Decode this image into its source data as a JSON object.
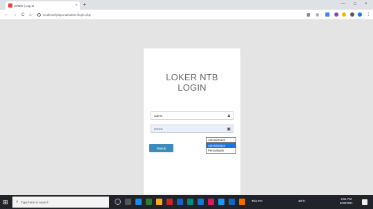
{
  "browser": {
    "tab_title": "ERES | Log in",
    "tab_close": "×",
    "new_tab": "+",
    "url": "localhost/jobportal/admin/login.php",
    "back": "←",
    "forward": "→",
    "reload": "C",
    "home": "⌂",
    "minimize": "—",
    "maximize": "□",
    "close": "×"
  },
  "login": {
    "brand_line1": "LOKER NTB",
    "brand_line2": "LOGIN",
    "username_value": "admin",
    "password_value": "••••••••",
    "submit_label": "Masuk",
    "role_selected": "Administrator",
    "role_options": [
      "Administrator",
      "Perusahaan"
    ]
  },
  "taskbar": {
    "search_placeholder": "Type here to search",
    "tray_weather": "29°C",
    "tray_label": "This PC",
    "time": "2:51 PM",
    "date": "9/30/2021"
  },
  "colors": {
    "accent": "#3c8dbc",
    "page_bg": "#e4e4e4",
    "taskbar_bg": "#20242a"
  }
}
